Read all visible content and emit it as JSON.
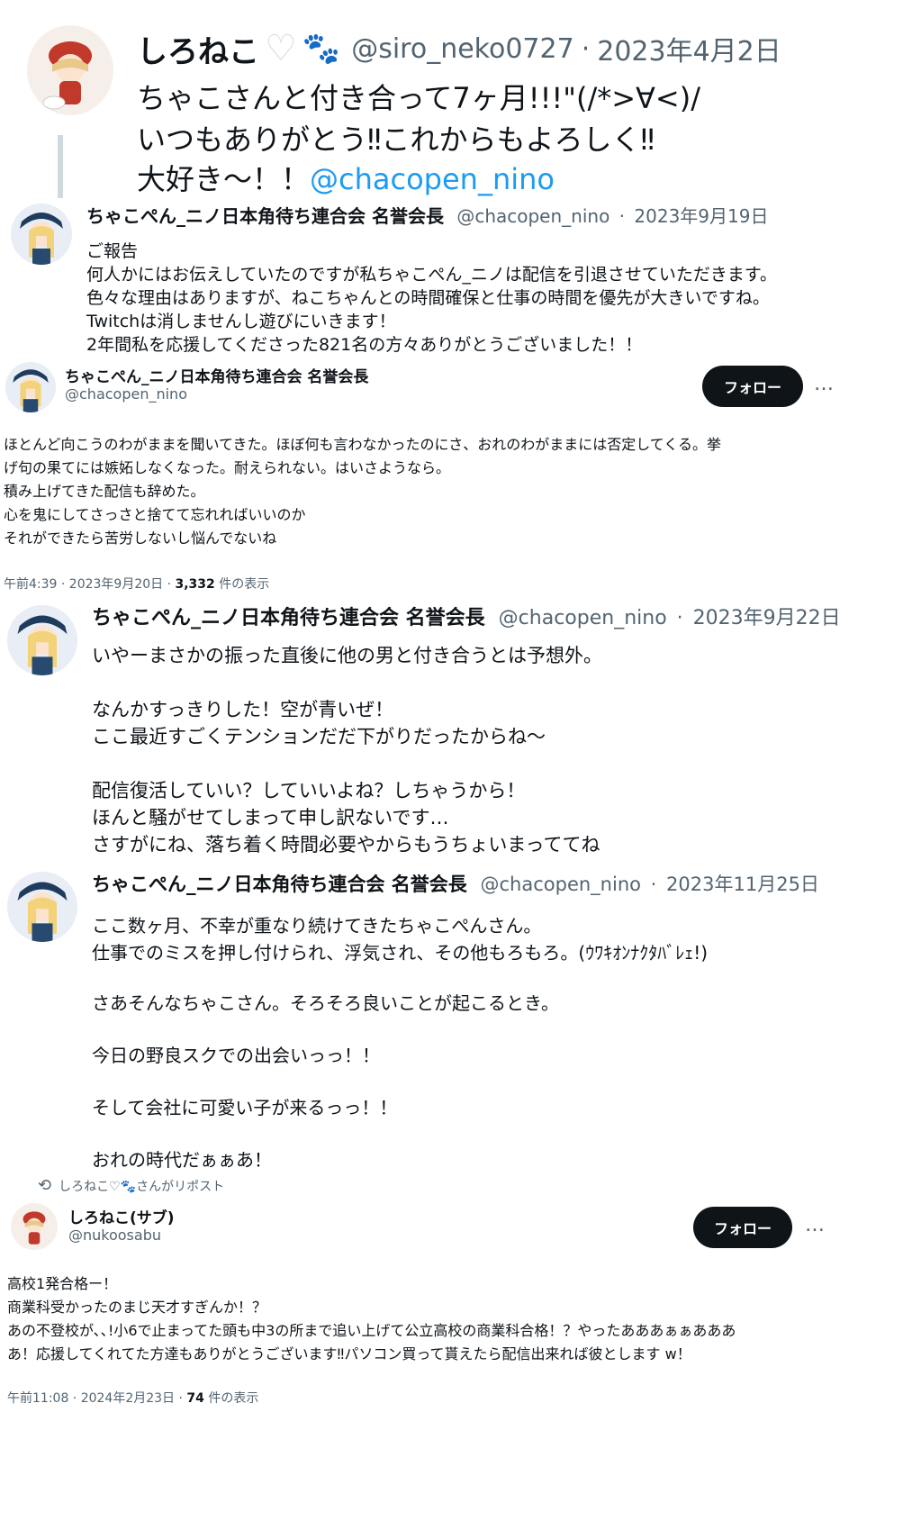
{
  "post1": {
    "name": "しろねこ",
    "heart": "♡",
    "paw": "🐾",
    "handle": "@siro_neko0727",
    "sep": "·",
    "date": "2023年4月2日",
    "line1": "ちゃこさんと付き合って7ヶ月!!!\"(/*>∀<)/",
    "line2": "いつもありがとう‼これからもよろしく‼",
    "line3_text": "大好き〜！！",
    "line3_mention": "@chacopen_nino"
  },
  "post2": {
    "name": "ちゃこぺん_ニノ日本角待ち連合会 名誉会長",
    "handle": "@chacopen_nino",
    "sep": "·",
    "date": "2023年9月19日",
    "lines": [
      "ご報告",
      "何人かにはお伝えしていたのですが私ちゃこぺん_ニノは配信を引退させていただきます。",
      "色々な理由はありますが、ねこちゃんとの時間確保と仕事の時間を優先が大きいですね。",
      "Twitchは消しませんし遊びにいきます！",
      "2年間私を応援してくださった821名の方々ありがとうございました！！"
    ]
  },
  "post3": {
    "name": "ちゃこぺん_ニノ日本角待ち連合会 名誉会長",
    "handle": "@chacopen_nino",
    "follow_label": "フォロー",
    "more": "…",
    "lines": [
      "ほとんど向こうのわがままを聞いてきた。ほぼ何も言わなかったのにさ、おれのわがままには否定してくる。挙",
      "げ句の果てには嫉妬しなくなった。耐えられない。はいさようなら。",
      "積み上げてきた配信も辞めた。",
      "心を鬼にしてさっさと捨てて忘れればいいのか",
      "それができたら苦労しないし悩んでないね"
    ],
    "meta_time": "午前4:39 · 2023年9月20日 · ",
    "meta_views": "3,332",
    "meta_suffix": " 件の表示"
  },
  "post4": {
    "name": "ちゃこぺん_ニノ日本角待ち連合会 名誉会長",
    "handle": "@chacopen_nino",
    "sep": "·",
    "date": "2023年9月22日",
    "lines": [
      "いやーまさかの振った直後に他の男と付き合うとは予想外。",
      "",
      "なんかすっきりした！空が青いぜ！",
      "ここ最近すごくテンションだだ下がりだったからね〜",
      "",
      "配信復活していい？していいよね？しちゃうから！",
      "ほんと騒がせてしまって申し訳ないです…",
      "さすがにね、落ち着く時間必要やからもうちょいまっててね"
    ]
  },
  "post5": {
    "name": "ちゃこぺん_ニノ日本角待ち連合会 名誉会長",
    "handle": "@chacopen_nino",
    "sep": "·",
    "date": "2023年11月25日",
    "lines": [
      "ここ数ヶ月、不幸が重なり続けてきたちゃこぺんさん。",
      "仕事でのミスを押し付けられ、浮気され、その他もろもろ。(ｳﾜｷｵﾝﾅｸﾀﾊﾞﾚｪ!)",
      "",
      "さあそんなちゃこさん。そろそろ良いことが起こるとき。",
      "",
      "今日の野良スクでの出会いっっ！！",
      "",
      "そして会社に可愛い子が来るっっ！！",
      "",
      "おれの時代だぁぁあ！"
    ]
  },
  "post6": {
    "repost_icon": "⟲",
    "repost_text": "しろねこ♡🐾さんがリポスト",
    "name": "しろねこ(サブ)",
    "handle": "@nukoosabu",
    "follow_label": "フォロー",
    "more": "…",
    "lines": [
      "高校1発合格ー！",
      "商業科受かったのまじ天才すぎんか！？",
      "あの不登校が､､!小6で止まってた頭も中3の所まで追い上げて公立高校の商業科合格！？やったあああぁぁあああ",
      "あ！応援してくれてた方達もありがとうございます‼パソコン買って貰えたら配信出来れば彼とします w！"
    ],
    "meta_time": "午前11:08 · 2024年2月23日 · ",
    "meta_views": "74",
    "meta_suffix": " 件の表示"
  }
}
